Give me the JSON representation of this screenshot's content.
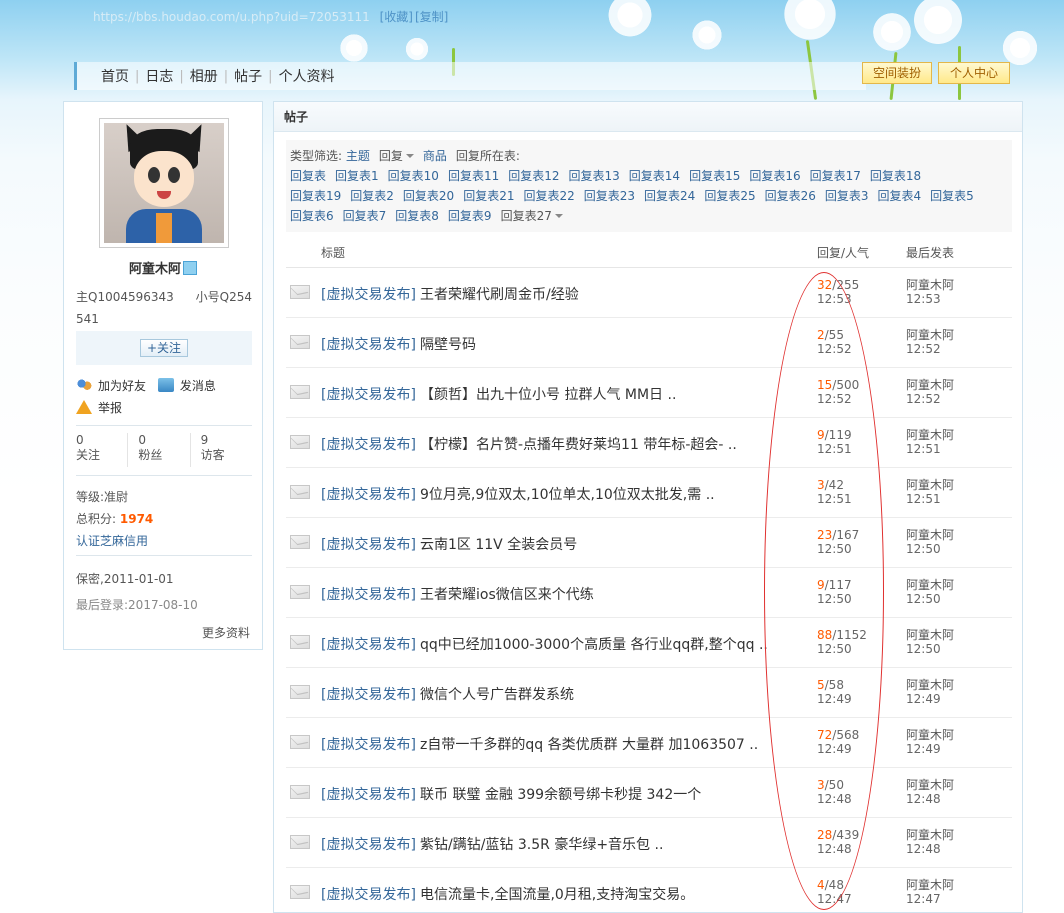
{
  "browser": {
    "url": "https://bbs.houdao.com/u.php?uid=72053111",
    "favorite": "[收藏]",
    "copy": "[复制]"
  },
  "nav": {
    "items": [
      "首页",
      "日志",
      "相册",
      "帖子",
      "个人资料"
    ]
  },
  "top_buttons": {
    "decorate": "空间装扮",
    "center": "个人中心"
  },
  "profile": {
    "name": "阿童木阿",
    "main_qq": "主Q1004596343",
    "sub_qq_line1": "小号Q254",
    "sub_qq_line2": "541",
    "follow": "+关注",
    "add_friend": "加为好友",
    "send_msg": "发消息",
    "report": "举报",
    "stats": [
      {
        "num": "0",
        "label": "关注"
      },
      {
        "num": "0",
        "label": "粉丝"
      },
      {
        "num": "9",
        "label": "访客"
      }
    ],
    "rank_label": "等级:",
    "rank": "准尉",
    "points_label": "总积分:",
    "points": "1974",
    "cert": "认证芝麻信用",
    "secret_label": "保密,",
    "secret_date": "2011-01-01",
    "last_login_label": "最后登录:",
    "last_login": "2017-08-10",
    "more": "更多资料"
  },
  "main": {
    "title": "帖子",
    "filter": {
      "type_label": "类型筛选:",
      "topic": "主题",
      "reply": "回复",
      "goods": "商品",
      "table_label": "回复所在表:",
      "tables_row1": [
        "回复表",
        "回复表1",
        "回复表10",
        "回复表11",
        "回复表12",
        "回复表13",
        "回复表14",
        "回复表15",
        "回复表16",
        "回复表17",
        "回复表18"
      ],
      "tables_row2": [
        "回复表19",
        "回复表2",
        "回复表20",
        "回复表21",
        "回复表22",
        "回复表23",
        "回复表24",
        "回复表25",
        "回复表26",
        "回复表3",
        "回复表4",
        "回复表5"
      ],
      "tables_row3": [
        "回复表6",
        "回复表7",
        "回复表8",
        "回复表9"
      ],
      "tables_more": "回复表27"
    },
    "columns": {
      "title": "标题",
      "reply": "回复/人气",
      "last": "最后发表"
    },
    "rows": [
      {
        "cat": "[虚拟交易发布]",
        "title": "王者荣耀代刷周金币/经验",
        "replies": "32",
        "views": "/255",
        "time": "12:53",
        "user": "阿童木阿",
        "ltime": "12:53"
      },
      {
        "cat": "[虚拟交易发布]",
        "title": "隔壁号码",
        "replies": "2",
        "views": "/55",
        "time": "12:52",
        "user": "阿童木阿",
        "ltime": "12:52"
      },
      {
        "cat": "[虚拟交易发布]",
        "title": "【颜哲】出九十位小号  拉群人气 MM日 ..",
        "replies": "15",
        "views": "/500",
        "time": "12:52",
        "user": "阿童木阿",
        "ltime": "12:52"
      },
      {
        "cat": "[虚拟交易发布]",
        "title": "【柠檬】名片赞-点播年费好莱坞11 带年标-超会- ..",
        "replies": "9",
        "views": "/119",
        "time": "12:51",
        "user": "阿童木阿",
        "ltime": "12:51"
      },
      {
        "cat": "[虚拟交易发布]",
        "title": "9位月亮,9位双太,10位单太,10位双太批发,需 ..",
        "replies": "3",
        "views": "/42",
        "time": "12:51",
        "user": "阿童木阿",
        "ltime": "12:51"
      },
      {
        "cat": "[虚拟交易发布]",
        "title": "云南1区 11V 全装会员号",
        "replies": "23",
        "views": "/167",
        "time": "12:50",
        "user": "阿童木阿",
        "ltime": "12:50"
      },
      {
        "cat": "[虚拟交易发布]",
        "title": "王者荣耀ios微信区来个代练",
        "replies": "9",
        "views": "/117",
        "time": "12:50",
        "user": "阿童木阿",
        "ltime": "12:50"
      },
      {
        "cat": "[虚拟交易发布]",
        "title": "qq中已经加1000-3000个高质量 各行业qq群,整个qq ..",
        "replies": "88",
        "views": "/1152",
        "time": "12:50",
        "user": "阿童木阿",
        "ltime": "12:50"
      },
      {
        "cat": "[虚拟交易发布]",
        "title": "微信个人号广告群发系统",
        "replies": "5",
        "views": "/58",
        "time": "12:49",
        "user": "阿童木阿",
        "ltime": "12:49"
      },
      {
        "cat": "[虚拟交易发布]",
        "title": "z自带一千多群的qq 各类优质群 大量群 加1063507 ..",
        "replies": "72",
        "views": "/568",
        "time": "12:49",
        "user": "阿童木阿",
        "ltime": "12:49"
      },
      {
        "cat": "[虚拟交易发布]",
        "title": "联币 联璧 金融 399余额号绑卡秒提 342一个",
        "replies": "3",
        "views": "/50",
        "time": "12:48",
        "user": "阿童木阿",
        "ltime": "12:48"
      },
      {
        "cat": "[虚拟交易发布]",
        "title": "紫钻/蹒钻/蓝钻 3.5R   豪华绿+音乐包 ..",
        "replies": "28",
        "views": "/439",
        "time": "12:48",
        "user": "阿童木阿",
        "ltime": "12:48"
      },
      {
        "cat": "[虚拟交易发布]",
        "title": "电信流量卡,全国流量,0月租,支持淘宝交易。",
        "replies": "4",
        "views": "/48",
        "time": "12:47",
        "user": "阿童木阿",
        "ltime": "12:47"
      }
    ]
  },
  "colors": {
    "link": "#336699",
    "accent": "#ff5a00",
    "annotation": "#e0302f"
  },
  "icons": [
    "envelope-icon",
    "friend-icon",
    "message-icon",
    "warning-icon",
    "vip-icon",
    "caret-down-icon"
  ]
}
